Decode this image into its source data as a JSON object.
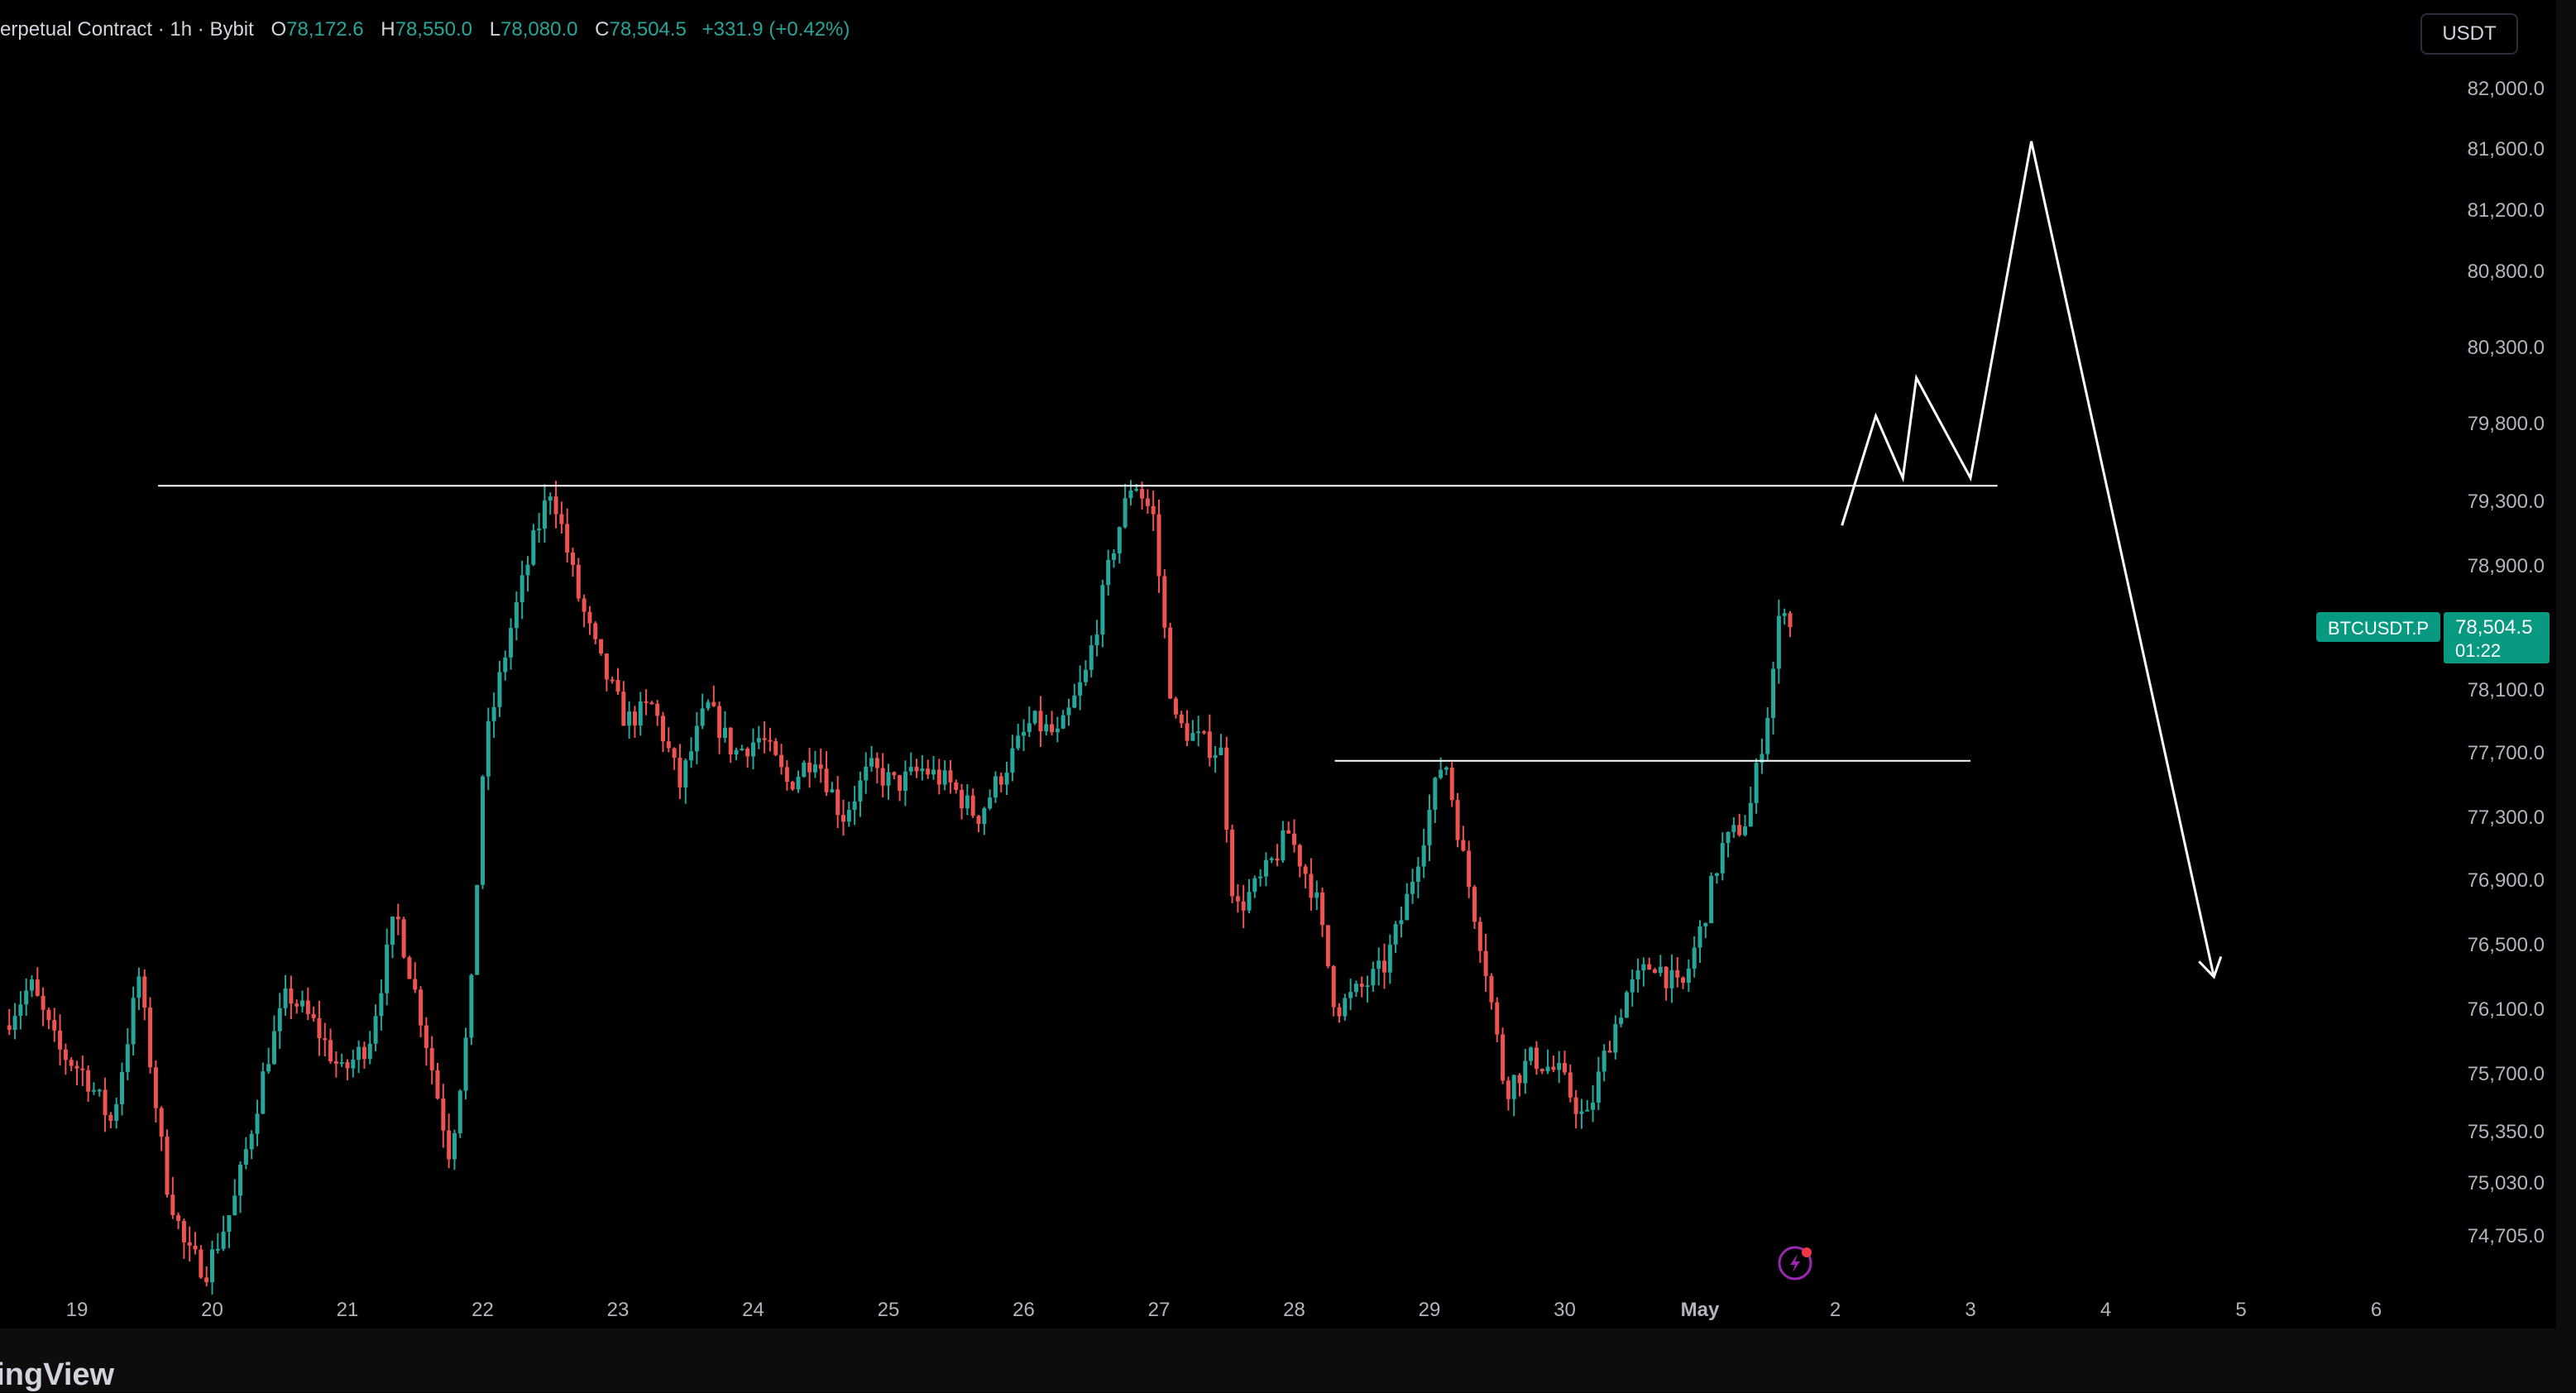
{
  "legend": {
    "symbol": "erpetual Contract · 1h · Bybit",
    "open_label": "O",
    "open": "78,172.6",
    "high_label": "H",
    "high": "78,550.0",
    "low_label": "L",
    "low": "78,080.0",
    "close_label": "C",
    "close": "78,504.5",
    "change": "+331.9 (+0.42%)"
  },
  "currency_button": "USDT",
  "price_tag": {
    "symbol": "BTCUSDT.P",
    "price": "78,504.5",
    "countdown": "01:22"
  },
  "brand": "dingView",
  "colors": {
    "up": "#26a69a",
    "down": "#ef5350",
    "background": "#000000",
    "axis_text": "#b2b5be",
    "drawing": "#ffffff"
  },
  "chart_data": {
    "type": "candlestick",
    "interval": "1h",
    "x_tick_labels": [
      "19",
      "20",
      "21",
      "22",
      "23",
      "24",
      "25",
      "26",
      "27",
      "28",
      "29",
      "30",
      "May",
      "2",
      "3",
      "4",
      "5",
      "6"
    ],
    "y_tick_labels": [
      "82,000.0",
      "81,600.0",
      "81,200.0",
      "80,800.0",
      "80,300.0",
      "79,800.0",
      "79,300.0",
      "78,900.0",
      "78,100.0",
      "77,700.0",
      "77,300.0",
      "76,900.0",
      "76,500.0",
      "76,100.0",
      "75,700.0",
      "75,350.0",
      "75,030.0",
      "74,705.0"
    ],
    "ohlc_path_approx": [
      [
        18.5,
        76000
      ],
      [
        18.7,
        76250
      ],
      [
        18.9,
        75850
      ],
      [
        19.1,
        75700
      ],
      [
        19.3,
        75400
      ],
      [
        19.5,
        76300
      ],
      [
        19.7,
        75050
      ],
      [
        19.85,
        74600
      ],
      [
        20.0,
        74500
      ],
      [
        20.2,
        74900
      ],
      [
        20.45,
        75800
      ],
      [
        20.6,
        76200
      ],
      [
        20.8,
        76000
      ],
      [
        21.0,
        75700
      ],
      [
        21.2,
        75900
      ],
      [
        21.4,
        76700
      ],
      [
        21.6,
        76000
      ],
      [
        21.8,
        75200
      ],
      [
        21.95,
        76100
      ],
      [
        22.05,
        77700
      ],
      [
        22.25,
        78500
      ],
      [
        22.4,
        79000
      ],
      [
        22.55,
        79400
      ],
      [
        22.75,
        78700
      ],
      [
        22.9,
        78300
      ],
      [
        23.1,
        77900
      ],
      [
        23.3,
        78000
      ],
      [
        23.5,
        77500
      ],
      [
        23.7,
        78000
      ],
      [
        23.9,
        77700
      ],
      [
        24.1,
        77800
      ],
      [
        24.3,
        77500
      ],
      [
        24.5,
        77700
      ],
      [
        24.7,
        77300
      ],
      [
        24.9,
        77600
      ],
      [
        25.1,
        77500
      ],
      [
        25.3,
        77600
      ],
      [
        25.5,
        77500
      ],
      [
        25.7,
        77300
      ],
      [
        25.9,
        77600
      ],
      [
        26.1,
        77900
      ],
      [
        26.3,
        77800
      ],
      [
        26.5,
        78200
      ],
      [
        26.7,
        79000
      ],
      [
        26.85,
        79450
      ],
      [
        27.0,
        79200
      ],
      [
        27.15,
        77900
      ],
      [
        27.3,
        77800
      ],
      [
        27.5,
        77700
      ],
      [
        27.6,
        76700
      ],
      [
        27.8,
        76900
      ],
      [
        28.0,
        77200
      ],
      [
        28.2,
        76800
      ],
      [
        28.35,
        76100
      ],
      [
        28.5,
        76200
      ],
      [
        28.7,
        76350
      ],
      [
        28.85,
        76700
      ],
      [
        29.0,
        77200
      ],
      [
        29.15,
        77700
      ],
      [
        29.3,
        77000
      ],
      [
        29.45,
        76400
      ],
      [
        29.6,
        75600
      ],
      [
        29.8,
        75800
      ],
      [
        30.0,
        75700
      ],
      [
        30.2,
        75400
      ],
      [
        30.35,
        75850
      ],
      [
        30.5,
        76200
      ],
      [
        30.7,
        76400
      ],
      [
        30.9,
        76200
      ],
      [
        31.05,
        76600
      ],
      [
        31.2,
        77100
      ],
      [
        31.4,
        77300
      ],
      [
        31.55,
        78000
      ],
      [
        31.65,
        78700
      ],
      [
        31.75,
        78500
      ]
    ],
    "last": {
      "open": 78172.6,
      "high": 78550.0,
      "low": 78080.0,
      "close": 78504.5
    },
    "annotations": {
      "resistance_line": {
        "price": 79400,
        "from_day": 19.6,
        "to_day": 33.2
      },
      "support_line": {
        "price": 77650,
        "from_day": 28.3,
        "to_day": 33.0
      },
      "projection_path": [
        [
          32.05,
          79150
        ],
        [
          32.3,
          79850
        ],
        [
          32.5,
          79450
        ],
        [
          32.6,
          80100
        ],
        [
          33.0,
          79450
        ],
        [
          33.45,
          81650
        ],
        [
          34.8,
          76300
        ]
      ]
    }
  }
}
